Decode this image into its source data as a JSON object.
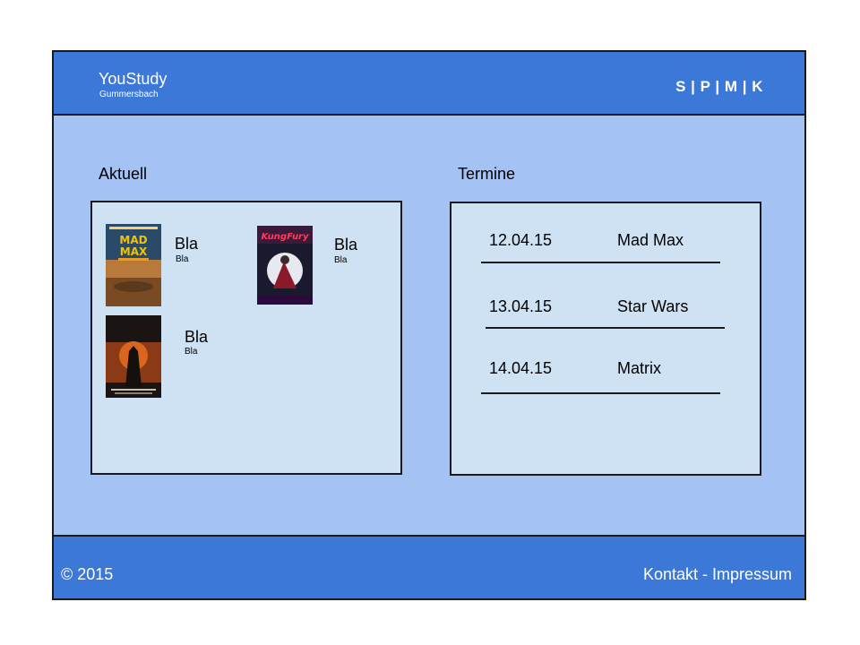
{
  "header": {
    "brand_title": "YouStudy",
    "brand_subtitle": "Gummersbach",
    "nav": "S | P | M | K"
  },
  "aktuell": {
    "title": "Aktuell",
    "movies": [
      {
        "title": "Bla",
        "subtitle": "Bla",
        "poster_icon": "mad-max-poster-icon",
        "poster_text": "MAD MAX"
      },
      {
        "title": "Bla",
        "subtitle": "Bla",
        "poster_icon": "kung-fury-poster-icon",
        "poster_text": "KungFury"
      },
      {
        "title": "Bla",
        "subtitle": "Bla",
        "poster_icon": "dark-knight-poster-icon",
        "poster_text": ""
      }
    ]
  },
  "termine": {
    "title": "Termine",
    "items": [
      {
        "date": "12.04.15",
        "name": "Mad Max"
      },
      {
        "date": "13.04.15",
        "name": "Star Wars"
      },
      {
        "date": "14.04.15",
        "name": "Matrix"
      }
    ]
  },
  "footer": {
    "copyright": "© 2015",
    "links": "Kontakt - Impressum"
  },
  "colors": {
    "header_footer": "#3c78d8",
    "body_background": "#a4c2f4",
    "panel_background": "#cfe2f3",
    "border": "#1a1a1a"
  }
}
